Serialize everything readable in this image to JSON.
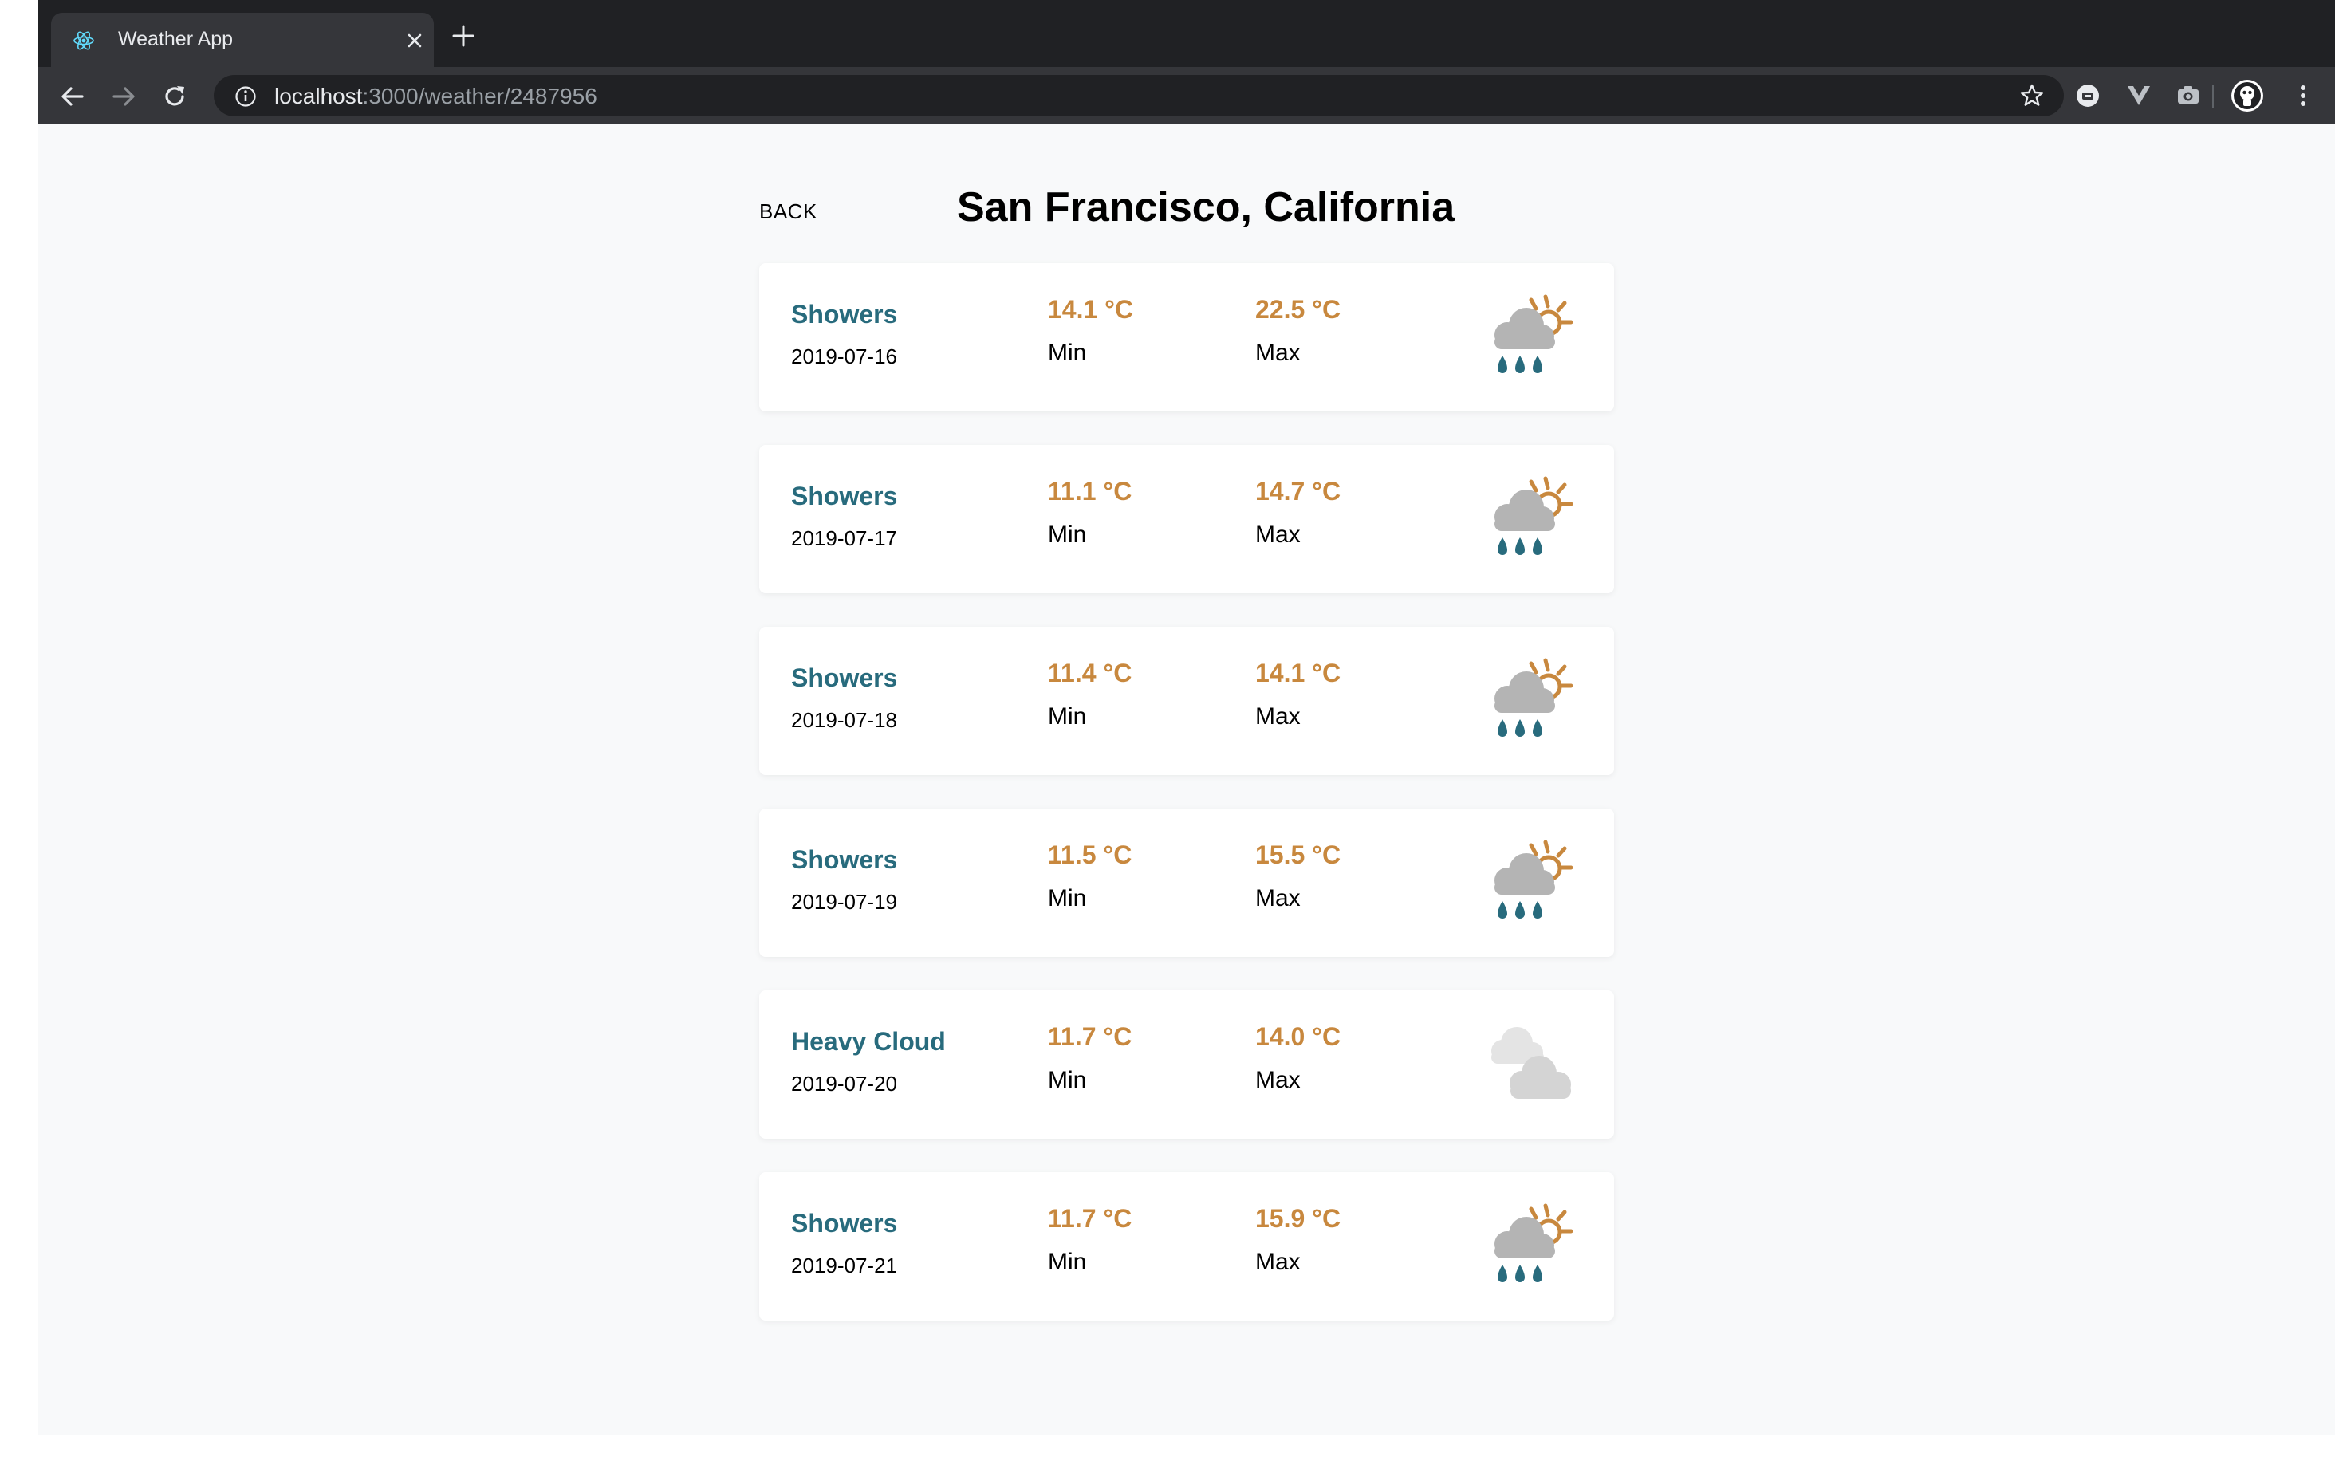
{
  "browser": {
    "tab_title": "Weather App",
    "url_host": "localhost",
    "url_path": ":3000/weather/2487956"
  },
  "page": {
    "back_label": "BACK",
    "title": "San Francisco, California"
  },
  "colors": {
    "condition": "#286b7d",
    "temperature": "#c8883e",
    "page_background": "#f8f9fa"
  },
  "forecast": [
    {
      "condition": "Showers",
      "date": "2019-07-16",
      "min": "14.1 °C",
      "min_label": "Min",
      "max": "22.5 °C",
      "max_label": "Max",
      "icon": "showers-icon"
    },
    {
      "condition": "Showers",
      "date": "2019-07-17",
      "min": "11.1 °C",
      "min_label": "Min",
      "max": "14.7 °C",
      "max_label": "Max",
      "icon": "showers-icon"
    },
    {
      "condition": "Showers",
      "date": "2019-07-18",
      "min": "11.4 °C",
      "min_label": "Min",
      "max": "14.1 °C",
      "max_label": "Max",
      "icon": "showers-icon"
    },
    {
      "condition": "Showers",
      "date": "2019-07-19",
      "min": "11.5 °C",
      "min_label": "Min",
      "max": "15.5 °C",
      "max_label": "Max",
      "icon": "showers-icon"
    },
    {
      "condition": "Heavy Cloud",
      "date": "2019-07-20",
      "min": "11.7 °C",
      "min_label": "Min",
      "max": "14.0 °C",
      "max_label": "Max",
      "icon": "heavy-cloud-icon"
    },
    {
      "condition": "Showers",
      "date": "2019-07-21",
      "min": "11.7 °C",
      "min_label": "Min",
      "max": "15.9 °C",
      "max_label": "Max",
      "icon": "showers-icon"
    }
  ]
}
